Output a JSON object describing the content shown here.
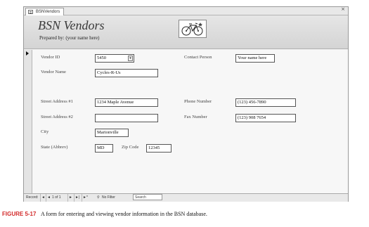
{
  "window": {
    "tab_label": "BSNVendors",
    "close_glyph": "×"
  },
  "header": {
    "title": "BSN Vendors",
    "subtitle": "Prepared by: (your name here)",
    "logo_icon": "bicycle-logo-icon"
  },
  "form": {
    "vendor_id": {
      "label": "Vendor ID",
      "value": "5450"
    },
    "vendor_name": {
      "label": "Vendor Name",
      "value": "Cycles-R-Us"
    },
    "contact_person": {
      "label": "Contact Person",
      "value": "Your name here"
    },
    "street_address_1": {
      "label": "Street Address #1",
      "value": "1234 Maple Avenue"
    },
    "street_address_2": {
      "label": "Street Address #2",
      "value": ""
    },
    "phone_number": {
      "label": "Phone Number",
      "value": "(123) 456-7890"
    },
    "fax_number": {
      "label": "Fax Number",
      "value": "(123) 908 7654"
    },
    "city": {
      "label": "City",
      "value": "Marionville"
    },
    "state": {
      "label": "State (Abbrev)",
      "value": "MD"
    },
    "zip_code": {
      "label": "Zip Code",
      "value": "12345"
    }
  },
  "navigation": {
    "record_label": "Record:",
    "first": "◄",
    "prev": "◄",
    "position": "1 of 1",
    "next": "►",
    "last": "►|",
    "new": "►*",
    "filter_label": "No Filter",
    "search_placeholder": "Search"
  },
  "caption": {
    "figure": "FIGURE 5-17",
    "text": "A form for entering and viewing vendor information in the BSN database."
  }
}
